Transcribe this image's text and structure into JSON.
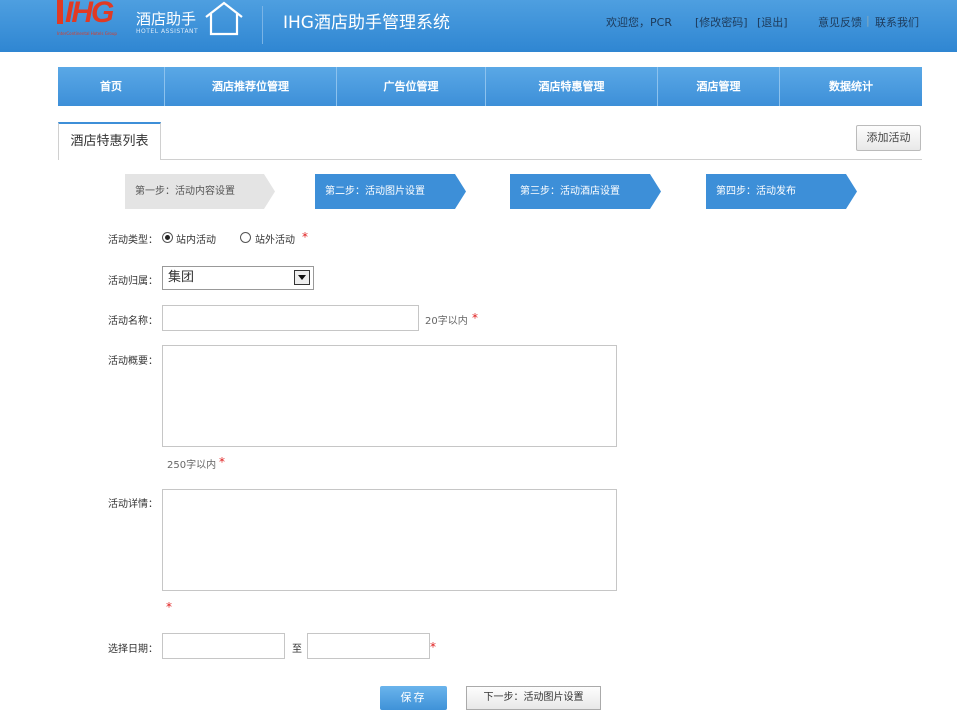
{
  "header": {
    "logo_text": "IHG",
    "logo_sub": "InterContinental Hotels Group",
    "brand_cn": "酒店助手",
    "brand_en": "HOTEL ASSISTANT",
    "system_title": "IHG酒店助手管理系统",
    "welcome": "欢迎您，PCR",
    "change_password": "[修改密码]",
    "logout": "[退出]",
    "feedback": "意见反馈",
    "contact": "联系我们"
  },
  "nav": {
    "items": [
      "首页",
      "酒店推荐位管理",
      "广告位管理",
      "酒店特惠管理",
      "酒店管理",
      "数据统计"
    ]
  },
  "tab": {
    "label": "酒店特惠列表"
  },
  "add_button": "添加活动",
  "steps": [
    {
      "label": "第一步：活动内容设置",
      "active": false
    },
    {
      "label": "第二步：活动图片设置",
      "active": true
    },
    {
      "label": "第三步：活动酒店设置",
      "active": true
    },
    {
      "label": "第四步：活动发布",
      "active": true
    }
  ],
  "form": {
    "type_label": "活动类型：",
    "type_option_internal": "站内活动",
    "type_option_external": "站外活动",
    "owner_label": "活动归属：",
    "owner_value": "集团",
    "name_label": "活动名称：",
    "name_hint": "20字以内",
    "summary_label": "活动概要：",
    "summary_hint": "250字以内",
    "detail_label": "活动详情：",
    "date_label": "选择日期：",
    "date_to": "至",
    "required_mark": "*"
  },
  "buttons": {
    "save": "保存",
    "next": "下一步：活动图片设置"
  },
  "colors": {
    "header_blue": "#3a8fd6",
    "step_active": "#3d8fd8",
    "step_inactive": "#e4e4e4",
    "required": "#e02020"
  }
}
